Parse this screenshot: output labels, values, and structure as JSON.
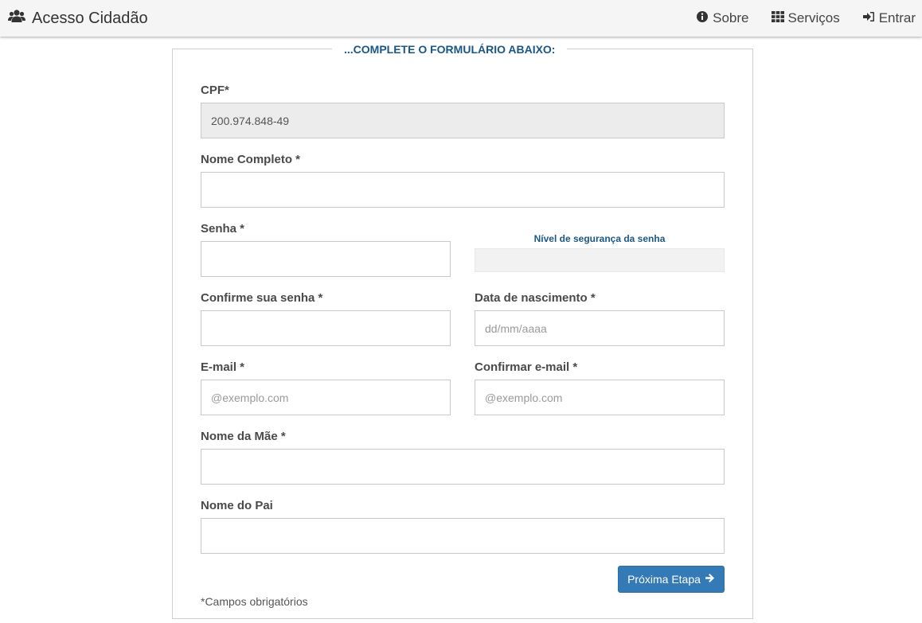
{
  "navbar": {
    "brand": "Acesso Cidadão",
    "brand_icon": "users-icon",
    "links": [
      {
        "label": "Sobre",
        "icon": "info-circle-icon"
      },
      {
        "label": "Serviços",
        "icon": "grid-icon"
      },
      {
        "label": "Entrar",
        "icon": "sign-in-icon"
      }
    ]
  },
  "form": {
    "legend": "...COMPLETE O FORMULÁRIO ABAIXO:",
    "cpf_label": "CPF*",
    "cpf_value": "200.974.848-49",
    "nome_label": "Nome Completo *",
    "senha_label": "Senha *",
    "strength_label": "Nível de segurança da senha",
    "confirme_senha_label": "Confirme sua senha *",
    "nascimento_label": "Data de nascimento *",
    "nascimento_placeholder": "dd/mm/aaaa",
    "email_label": "E-mail *",
    "email_placeholder": "@exemplo.com",
    "confirmar_email_label": "Confirmar e-mail *",
    "confirmar_email_placeholder": "@exemplo.com",
    "mae_label": "Nome da Mãe *",
    "pai_label": "Nome do Pai",
    "next_button": "Próxima Etapa",
    "required_note": "*Campos obrigatórios"
  },
  "colors": {
    "accent": "#1b5786",
    "button": "#337ab7"
  }
}
